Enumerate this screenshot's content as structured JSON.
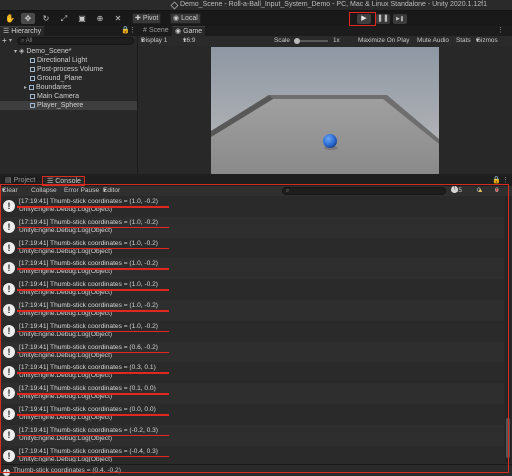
{
  "window": {
    "title": "Demo_Scene - Roll-a-Ball_Input_System_Demo - PC, Mac & Linux Standalone - Unity 2020.1.12f1"
  },
  "toolbar": {
    "tools": [
      "hand-tool-icon",
      "move-tool-icon",
      "rotate-tool-icon",
      "scale-tool-icon",
      "rect-tool-icon",
      "transform-tool-icon",
      "custom-tool-icon"
    ],
    "pivot_label": "Pivot",
    "local_label": "Local",
    "play_glyph": "▶",
    "pause_glyph": "❚❚",
    "step_glyph": "▶❚"
  },
  "hierarchy": {
    "tab_label": "Hierarchy",
    "add_label": "+",
    "search_placeholder": "All",
    "scene_name": "Demo_Scene*",
    "items": [
      {
        "label": "Directional Light"
      },
      {
        "label": "Post-process Volume"
      },
      {
        "label": "Ground_Plane"
      },
      {
        "label": "Boundaries"
      },
      {
        "label": "Main Camera"
      },
      {
        "label": "Player_Sphere"
      }
    ]
  },
  "scene_view": {
    "scene_tab": "Scene",
    "game_tab": "Game",
    "display": "Display 1",
    "aspect": "16:9",
    "scale_label": "Scale",
    "scale_value": "1x",
    "maximize_label": "Maximize On Play",
    "mute_label": "Mute Audio",
    "stats_label": "Stats",
    "gizmos_label": "Gizmos"
  },
  "console": {
    "project_tab": "Project",
    "console_tab": "Console",
    "clear_label": "Clear",
    "collapse_label": "Collapse",
    "error_pause_label": "Error Pause",
    "editor_label": "Editor",
    "log_count": "565",
    "warn_count": "0",
    "error_count": "0",
    "logs": [
      {
        "line1": "[17:19:41] Thumb-stick coordinates = (1.0, -0.2)",
        "line2": "UnityEngine.Debug:Log(Object)"
      },
      {
        "line1": "[17:19:41] Thumb-stick coordinates = (1.0, -0.2)",
        "line2": "UnityEngine.Debug:Log(Object)"
      },
      {
        "line1": "[17:19:41] Thumb-stick coordinates = (1.0, -0.2)",
        "line2": "UnityEngine.Debug:Log(Object)"
      },
      {
        "line1": "[17:19:41] Thumb-stick coordinates = (1.0, -0.2)",
        "line2": "UnityEngine.Debug:Log(Object)"
      },
      {
        "line1": "[17:19:41] Thumb-stick coordinates = (1.0, -0.2)",
        "line2": "UnityEngine.Debug:Log(Object)"
      },
      {
        "line1": "[17:19:41] Thumb-stick coordinates = (1.0, -0.2)",
        "line2": "UnityEngine.Debug:Log(Object)"
      },
      {
        "line1": "[17:19:41] Thumb-stick coordinates = (1.0, -0.2)",
        "line2": "UnityEngine.Debug:Log(Object)"
      },
      {
        "line1": "[17:19:41] Thumb-stick coordinates = (0.6, -0.2)",
        "line2": "UnityEngine.Debug:Log(Object)"
      },
      {
        "line1": "[17:19:41] Thumb-stick coordinates = (0.3, 0.1)",
        "line2": "UnityEngine.Debug:Log(Object)"
      },
      {
        "line1": "[17:19:41] Thumb-stick coordinates = (0.1, 0.0)",
        "line2": "UnityEngine.Debug:Log(Object)"
      },
      {
        "line1": "[17:19:41] Thumb-stick coordinates = (0.0, 0.0)",
        "line2": "UnityEngine.Debug:Log(Object)"
      },
      {
        "line1": "[17:19:41] Thumb-stick coordinates = (-0.2, 0.3)",
        "line2": "UnityEngine.Debug:Log(Object)"
      },
      {
        "line1": "[17:19:41] Thumb-stick coordinates = (-0.4, 0.3)",
        "line2": "UnityEngine.Debug:Log(Object)"
      }
    ],
    "status_text": "Thumb-stick coordinates = (0.4, -0.2)"
  },
  "colors": {
    "highlight_red": "#e0281e",
    "sphere_blue": "#2f6fd6"
  }
}
